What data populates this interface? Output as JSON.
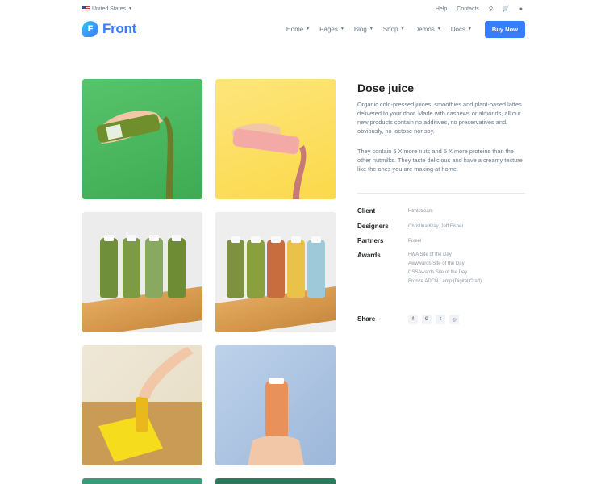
{
  "topbar": {
    "country": "United States",
    "help": "Help",
    "contacts": "Contacts",
    "icons": [
      "search-icon",
      "cart-icon",
      "user-icon"
    ]
  },
  "brand": {
    "mark": "F",
    "name": "Front"
  },
  "nav": {
    "items": [
      {
        "label": "Home"
      },
      {
        "label": "Pages"
      },
      {
        "label": "Blog"
      },
      {
        "label": "Shop"
      },
      {
        "label": "Demos"
      },
      {
        "label": "Docs"
      }
    ],
    "cta": "Buy Now"
  },
  "project": {
    "title": "Dose juice",
    "description_1": "Organic cold-pressed juices, smoothies and plant-based lattes delivered to your door. Made with cashews or almonds, all our new products contain no additives, no preservatives and, obviously, no lactose nor soy.",
    "description_2": "They contain 5 X more nuts and 5 X more proteins than the other nutmilks. They taste delicious and have a creamy texture like the ones you are making at home."
  },
  "meta": {
    "client_label": "Client",
    "client": "Htmlstream",
    "designers_label": "Designers",
    "designers": "Christina Kray, Jeff Fisher",
    "partners_label": "Partners",
    "partners": "Pixeel",
    "awards_label": "Awards",
    "awards": [
      "FWA Site of the Day",
      "Awwwards Site of the Day",
      "CSSAwards Site of the Day",
      "Bronze ADCN Lamp (Digital Craft)"
    ],
    "share_label": "Share",
    "share_icons": [
      {
        "name": "facebook-icon",
        "glyph": "f"
      },
      {
        "name": "google-icon",
        "glyph": "G"
      },
      {
        "name": "twitter-icon",
        "glyph": "t"
      },
      {
        "name": "github-icon",
        "glyph": "◎"
      }
    ]
  },
  "colors": {
    "accent": "#377dff",
    "text": "#1e2022",
    "muted": "#677788"
  }
}
